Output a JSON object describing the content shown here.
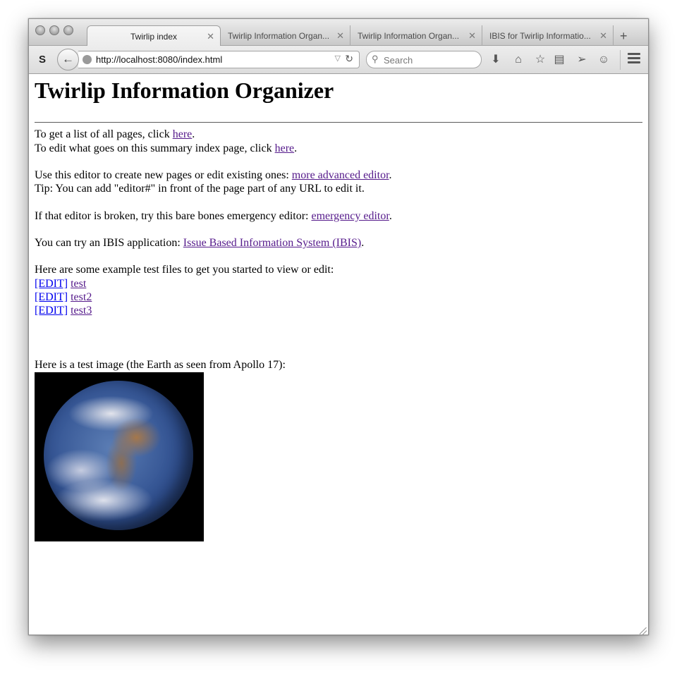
{
  "browser": {
    "tabs": [
      {
        "label": "Twirlip index",
        "active": true
      },
      {
        "label": "Twirlip Information Organ...",
        "active": false
      },
      {
        "label": "Twirlip Information Organ...",
        "active": false
      },
      {
        "label": "IBIS for Twirlip Informatio...",
        "active": false
      }
    ],
    "new_tab_label": "+",
    "close_glyph": "✕",
    "url": "http://localhost:8080/index.html",
    "search_placeholder": "Search",
    "icons": [
      "addon-s-icon",
      "back-arrow-icon",
      "globe-icon",
      "reload-icon",
      "search-icon",
      "download-icon",
      "home-icon",
      "bookmark-star-icon",
      "reading-list-icon",
      "send-icon",
      "chat-icon",
      "menu-icon"
    ]
  },
  "page": {
    "title": "Twirlip Information Organizer",
    "pages_prefix": "To get a list of all pages, click ",
    "pages_link": "here",
    "pages_suffix": ".",
    "edit_index_prefix": "To edit what goes on this summary index page, click ",
    "edit_index_link": "here",
    "edit_index_suffix": ".",
    "editor_prefix": "Use this editor to create new pages or edit existing ones: ",
    "editor_link": "more advanced editor",
    "editor_suffix": ".",
    "tip": "Tip: You can add \"editor#\" in front of the page part of any URL to edit it.",
    "emergency_prefix": "If that editor is broken, try this bare bones emergency editor: ",
    "emergency_link": "emergency editor",
    "emergency_suffix": ".",
    "ibis_prefix": "You can try an IBIS application: ",
    "ibis_link": "Issue Based Information System (IBIS)",
    "ibis_suffix": ".",
    "examples_intro": "Here are some example test files to get you started to view or edit:",
    "examples": [
      {
        "edit_label": "[EDIT]",
        "name": "test"
      },
      {
        "edit_label": "[EDIT]",
        "name": "test2"
      },
      {
        "edit_label": "[EDIT]",
        "name": "test3"
      }
    ],
    "image_caption": "Here is a test image (the Earth as seen from Apollo 17):"
  }
}
